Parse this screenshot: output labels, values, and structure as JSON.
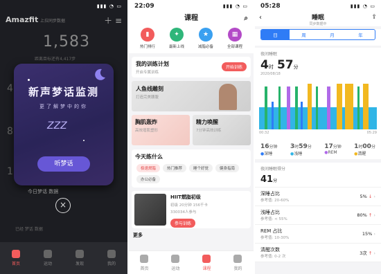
{
  "screen1": {
    "time": "",
    "logo": "Amazfit",
    "top_hint": "上拉同步数据",
    "steps": "1,583",
    "steps_sub": "距离目标还有4,417步",
    "left_numbers": [
      "4",
      "8",
      "1"
    ],
    "popup": {
      "title": "新声梦话监测",
      "subtitle": "更了解梦中的你",
      "zzz": "ZZZ",
      "button": "听梦话"
    },
    "bottom_hint": "今日梦话 数据",
    "note": "已经 梦话 数据",
    "tabs": [
      "首页",
      "运动",
      "发现",
      "我的"
    ]
  },
  "screen2": {
    "time": "22:09",
    "title": "课程",
    "categories": [
      {
        "label": "热门排行",
        "color": "#f25c5c",
        "icon": "chart-icon"
      },
      {
        "label": "最新上线",
        "color": "#2fb67a",
        "icon": "new-icon"
      },
      {
        "label": "减脂必备",
        "color": "#3aa0f0",
        "icon": "star-icon"
      },
      {
        "label": "全部课程",
        "color": "#b34ac7",
        "icon": "grid-icon"
      }
    ],
    "plan": {
      "title": "我的训练计划",
      "sub": "开启专属训练",
      "button": "开始训练"
    },
    "banner1": {
      "title": "人鱼线雕刻",
      "sub": "打造完美腰腹"
    },
    "banner2": {
      "title": "胸肌轰炸",
      "sub": "高效增肌塑形"
    },
    "banner3": {
      "title": "精力唤醒",
      "sub": "7分钟高效训练"
    },
    "today": {
      "title": "今天练什么",
      "chips": [
        "极速燃脂",
        "热门推荐",
        "睡个好觉",
        "健身指南",
        "办公必备"
      ]
    },
    "course": {
      "title": "HIIT燃脂初级",
      "meta": "初级 20分钟 156千卡",
      "sub": "330034人参与",
      "button": "参与训练"
    },
    "more": "更多",
    "tabs": [
      "首页",
      "运动",
      "课程",
      "我的"
    ]
  },
  "screen3": {
    "time": "05:28",
    "title": "睡眠",
    "subtitle": "同步数据中",
    "segments": [
      "日",
      "周",
      "月",
      "年"
    ],
    "section": "夜间睡眠",
    "hours": "4",
    "hours_unit": "时",
    "mins": "57",
    "mins_unit": "分",
    "date": "2020/08/18",
    "time_start": "00:32",
    "time_end": "05:29",
    "stats": [
      {
        "value": "16",
        "unit": "分钟",
        "label": "深睡",
        "color": "#2f7cf6"
      },
      {
        "value": "3",
        "unit": "时",
        "value2": "59",
        "unit2": "分",
        "label": "浅睡",
        "color": "#31b5e6"
      },
      {
        "value": "17",
        "unit": "分钟",
        "label": "REM",
        "color": "#b06ae8"
      },
      {
        "value": "1",
        "unit": "时",
        "value2": "00",
        "unit2": "分",
        "label": "清醒",
        "color": "#f2b820"
      }
    ],
    "score_label": "夜间睡眠得分",
    "score": "41",
    "score_unit": "分",
    "metrics": [
      {
        "title": "深睡占比",
        "ref": "参考值: 20-60%",
        "value": "5%",
        "arrow": "↓",
        "arrow_color": "#e34c4c"
      },
      {
        "title": "浅睡占比",
        "ref": "参考值: < 55%",
        "value": "80%",
        "arrow": "↑",
        "arrow_color": "#e34c4c"
      },
      {
        "title": "REM 占比",
        "ref": "参考值: 10-30%",
        "value": "15%",
        "arrow": "",
        "arrow_color": "#999"
      },
      {
        "title": "清醒次数",
        "ref": "参考值: 0-2 次",
        "value": "3次",
        "arrow": "↑",
        "arrow_color": "#e34c4c"
      }
    ]
  }
}
